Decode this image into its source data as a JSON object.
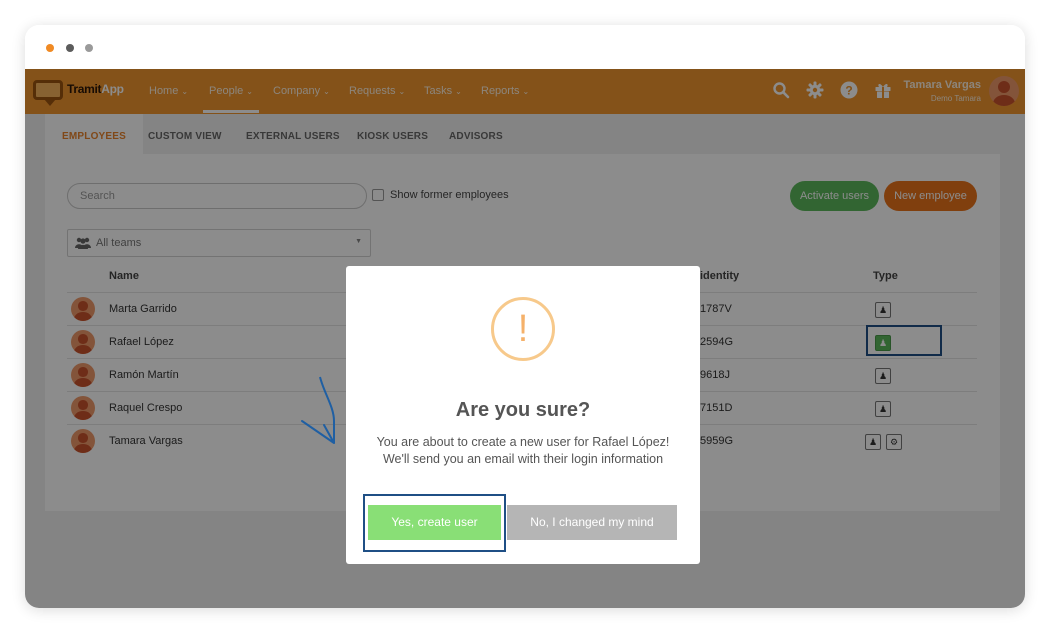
{
  "app": {
    "logo_brand": "Tramit",
    "logo_suffix": "App",
    "nav": [
      {
        "label": "Home",
        "chev": "⌄"
      },
      {
        "label": "People",
        "chev": "⌄"
      },
      {
        "label": "Company",
        "chev": "⌄"
      },
      {
        "label": "Requests",
        "chev": "⌄"
      },
      {
        "label": "Tasks",
        "chev": "⌄"
      },
      {
        "label": "Reports",
        "chev": "⌄"
      }
    ],
    "active_nav": "People",
    "icons": [
      "search-icon",
      "gear-icon",
      "help-icon",
      "gift-icon"
    ],
    "user": {
      "name": "Tamara Vargas",
      "company": "Demo Tamara"
    }
  },
  "tabs": [
    {
      "label": "EMPLOYEES"
    },
    {
      "label": "CUSTOM VIEW"
    },
    {
      "label": "EXTERNAL USERS"
    },
    {
      "label": "KIOSK USERS"
    },
    {
      "label": "ADVISORS"
    }
  ],
  "active_tab": "EMPLOYEES",
  "toolbar": {
    "search_placeholder": "Search",
    "show_former_label": "Show former employees",
    "activate_label": "Activate users",
    "new_employee_label": "New employee",
    "teams_label": "All teams"
  },
  "table": {
    "headers": {
      "name": "Name",
      "identity": "identity",
      "type": "Type"
    },
    "rows": [
      {
        "name": "Marta Garrido",
        "identity": "1787V"
      },
      {
        "name": "Rafael López",
        "identity": "2594G"
      },
      {
        "name": "Ramón Martín",
        "identity": "9618J"
      },
      {
        "name": "Raquel Crespo",
        "identity": "7151D"
      },
      {
        "name": "Tamara Vargas",
        "identity": "5959G"
      }
    ]
  },
  "modal": {
    "icon": "!",
    "title": "Are you sure?",
    "line1": "You are about to create a new user for Rafael López!",
    "line2": "We'll send you an email with their login information",
    "confirm_label": "Yes, create user",
    "cancel_label": "No, I changed my mind"
  },
  "colors": {
    "nav_orange": "#f1962e",
    "accent_orange": "#e9731a",
    "green": "#5cb85c",
    "modal_green": "#89df76",
    "highlight_blue": "#1f4f85"
  }
}
